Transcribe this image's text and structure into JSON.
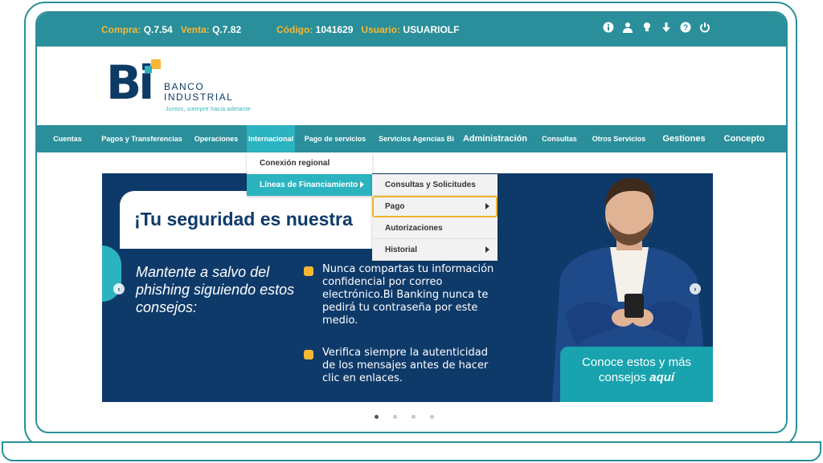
{
  "topbar": {
    "compra_label": "Compra:",
    "compra_value": "Q.7.54",
    "venta_label": "Venta:",
    "venta_value": "Q.7.82",
    "codigo_label": "Código:",
    "codigo_value": "1041629",
    "usuario_label": "Usuario:",
    "usuario_value": "USUARIOLF",
    "icons": [
      "info-icon",
      "user-icon",
      "lightbulb-icon",
      "download-icon",
      "help-icon",
      "power-icon"
    ]
  },
  "header": {
    "logo_text": "Bi",
    "brand_line1": "BANCO",
    "brand_line2": "INDUSTRIAL",
    "slogan": "Juntos, siempre hacia adelante"
  },
  "nav": {
    "items": [
      {
        "label": "Cuentas"
      },
      {
        "label": "Pagos y Transferencias"
      },
      {
        "label": "Operaciones"
      },
      {
        "label": "Internacional"
      },
      {
        "label": "Pago de servicios"
      },
      {
        "label": "Servicios Agencias Bi"
      },
      {
        "label": "Administración"
      },
      {
        "label": "Consultas"
      },
      {
        "label": "Otros Servicios"
      },
      {
        "label": "Gestiones"
      },
      {
        "label": "Concepto"
      }
    ]
  },
  "dropdown_internacional": {
    "items": [
      {
        "label": "Conexión regional"
      },
      {
        "label": "Líneas de Financiamiento"
      }
    ]
  },
  "dropdown_lineas": {
    "items": [
      {
        "label": "Consultas y Solicitudes"
      },
      {
        "label": "Pago"
      },
      {
        "label": "Autorizaciones"
      },
      {
        "label": "Historial"
      }
    ]
  },
  "banner": {
    "title": "¡Tu seguridad es nuestra",
    "subtitle": "Mantente a salvo del phishing siguiendo estos consejos:",
    "tip1": "Nunca compartas tu información confidencial por correo electrónico.Bi Banking nunca te pedirá tu contraseña por este medio.",
    "tip2": "Verifica siempre la autenticidad de los mensajes antes de hacer clic en enlaces.",
    "cta_line1": "Conoce estos y más",
    "cta_line2": "consejos",
    "cta_link": "aquí"
  },
  "carousel": {
    "total": 4,
    "active_index": 0
  },
  "colors": {
    "primary": "#2a8f9a",
    "accent": "#f7b733",
    "navy": "#0e3a6a",
    "teal": "#2bb3c0"
  }
}
